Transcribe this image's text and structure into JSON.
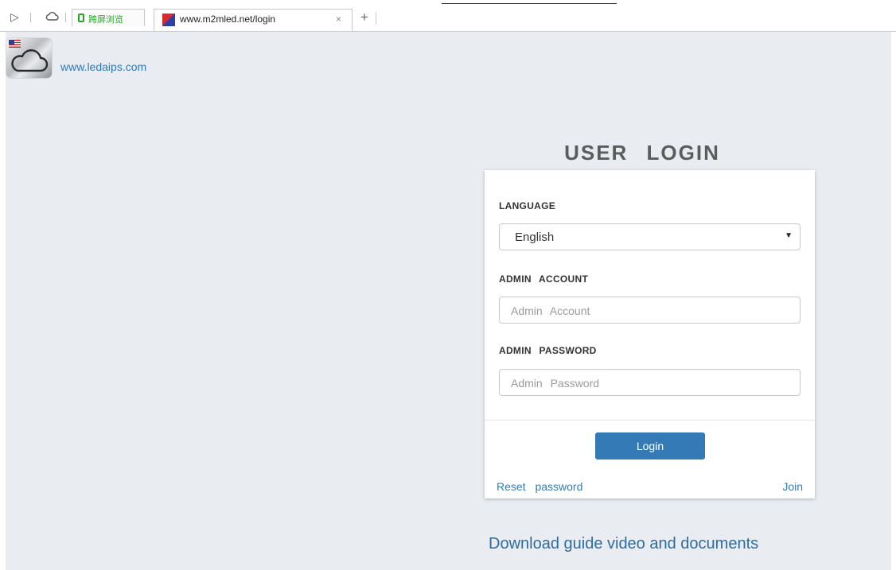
{
  "browser": {
    "tab_special_label": "跨屏浏览",
    "tab_active_label": "www.m2mled.net/login",
    "tab_close_glyph": "×",
    "new_tab_glyph": "+",
    "toolbar_icons": [
      "sidebar-toggle-icon",
      "cloud-icon"
    ]
  },
  "header": {
    "site_link": "www.ledaips.com"
  },
  "login": {
    "title": "USER LOGIN",
    "language_label": "LANGUAGE",
    "language_value": "English",
    "account_label": "ADMIN ACCOUNT",
    "account_placeholder": "Admin Account",
    "password_label": "ADMIN PASSWORD",
    "password_placeholder": "Admin Password",
    "login_button": "Login",
    "reset_link": "Reset password",
    "join_link": "Join"
  },
  "footer": {
    "download_link": "Download guide video and documents"
  },
  "colors": {
    "page_background": "#e9edf1",
    "accent": "#337ab7",
    "title_gray": "#5c5c5c"
  }
}
